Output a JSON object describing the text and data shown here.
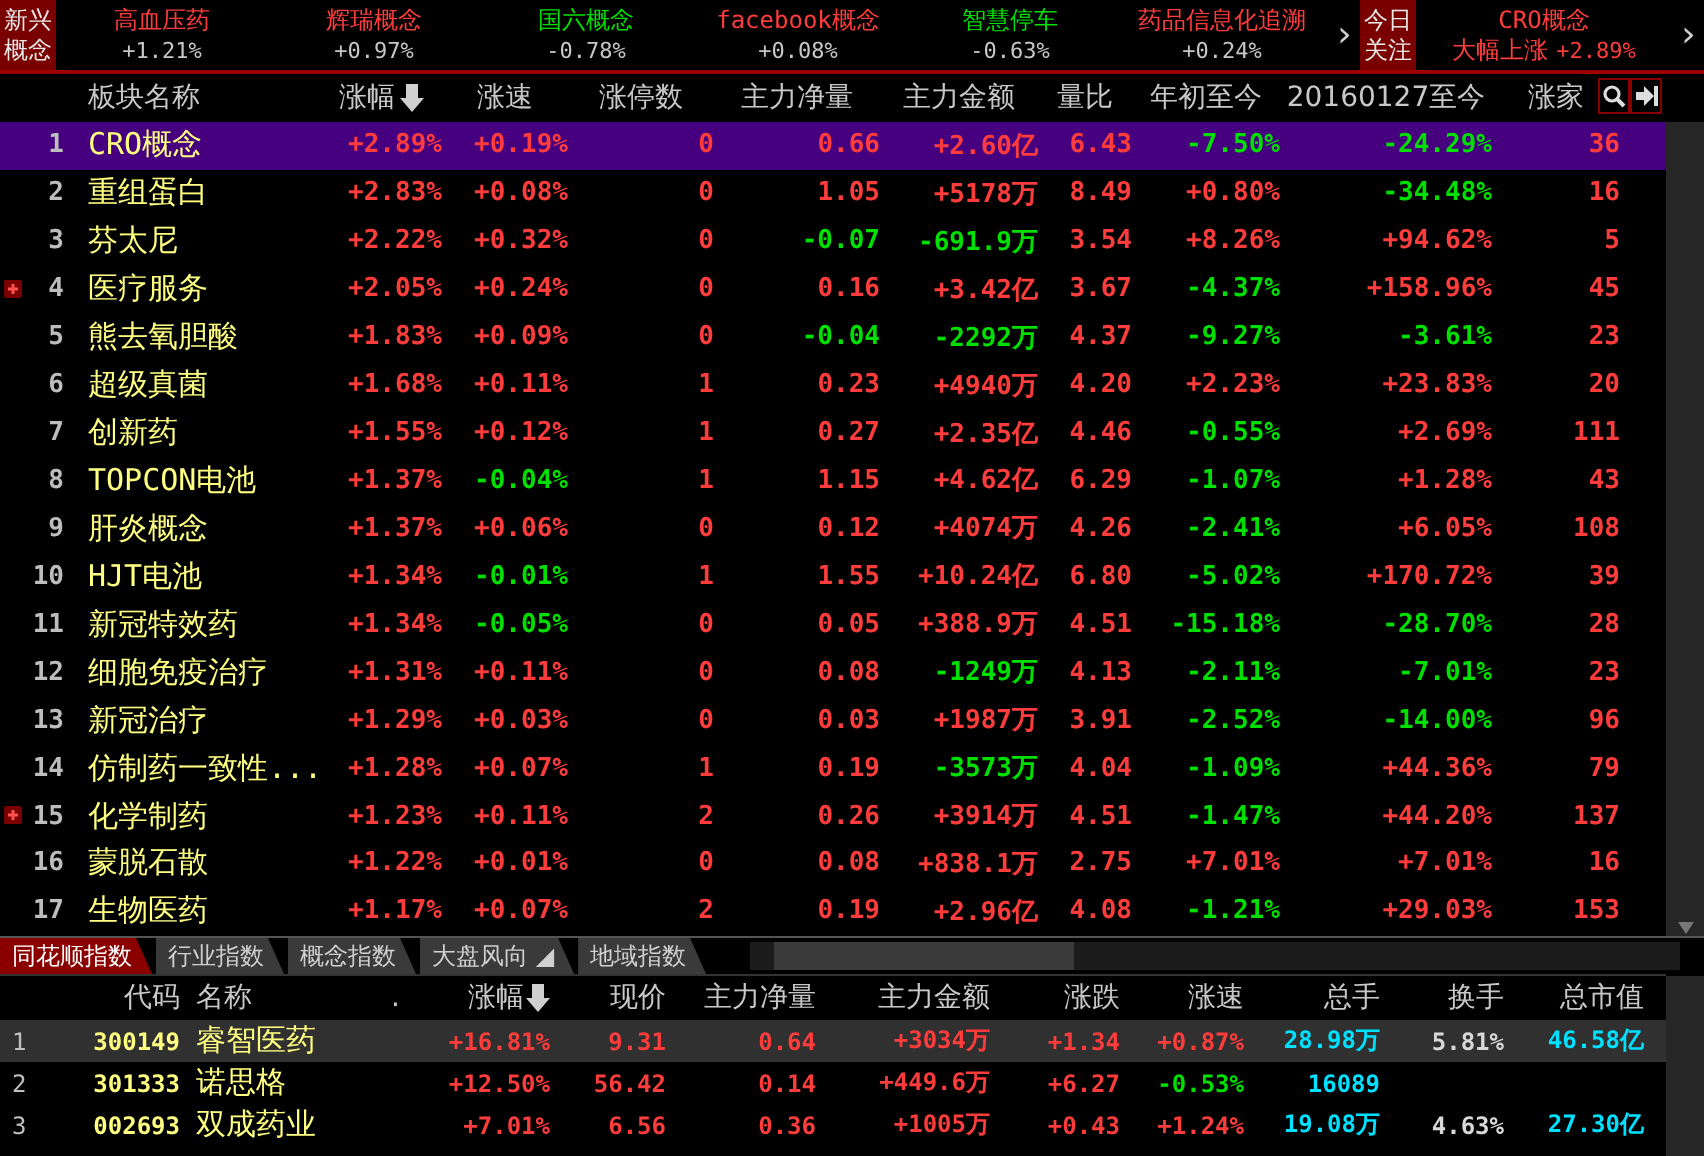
{
  "ticker": {
    "label": "新兴概念",
    "items": [
      {
        "name": "高血压药",
        "change": "+1.21%",
        "color": "#ff3c3c"
      },
      {
        "name": "辉瑞概念",
        "change": "+0.97%",
        "color": "#ff3c3c"
      },
      {
        "name": "国六概念",
        "change": "-0.78%",
        "color": "#00e000"
      },
      {
        "name": "facebook概念",
        "change": "+0.08%",
        "color": "#ff3c3c"
      },
      {
        "name": "智慧停车",
        "change": "-0.63%",
        "color": "#00e000"
      },
      {
        "name": "药品信息化追溯",
        "change": "+0.24%",
        "color": "#ff3c3c"
      }
    ],
    "arrow": "›",
    "focus_label": "今日关注",
    "focus": {
      "name": "CRO概念",
      "note": "大幅上涨",
      "change": "+2.89%",
      "color": "#ff3c3c"
    },
    "focus_arrow": "›"
  },
  "sectors": {
    "columns": [
      {},
      {
        "label": "板块名称",
        "sorted": false
      },
      {
        "label": "涨幅",
        "sorted": true
      },
      {
        "label": "涨速",
        "sorted": false
      },
      {
        "label": "涨停数",
        "sorted": false
      },
      {
        "label": "主力净量",
        "sorted": false
      },
      {
        "label": "主力金额",
        "sorted": false
      },
      {
        "label": "量比",
        "sorted": false
      },
      {
        "label": "年初至今",
        "sorted": false
      },
      {
        "label": "20160127至今",
        "sorted": false
      },
      {
        "label": "涨家",
        "sorted": false
      }
    ],
    "rows": [
      {
        "selected": true,
        "expandable": false,
        "cells": [
          {
            "text": "1",
            "color": "#bdbdbd"
          },
          {
            "text": "CRO概念",
            "color": "#ffff80"
          },
          {
            "text": "+2.89%",
            "color": "#ff3c3c"
          },
          {
            "text": "+0.19%",
            "color": "#ff3c3c"
          },
          {
            "text": "0",
            "color": "#ff3c3c"
          },
          {
            "text": "0.66",
            "color": "#ff3c3c"
          },
          {
            "text": "+2.60亿",
            "color": "#ff3c3c"
          },
          {
            "text": "6.43",
            "color": "#ff3c3c"
          },
          {
            "text": "-7.50%",
            "color": "#00e000"
          },
          {
            "text": "-24.29%",
            "color": "#00e000"
          },
          {
            "text": "36",
            "color": "#ff3c3c"
          }
        ]
      },
      {
        "selected": false,
        "expandable": false,
        "cells": [
          {
            "text": "2",
            "color": "#bdbdbd"
          },
          {
            "text": "重组蛋白",
            "color": "#ffff80"
          },
          {
            "text": "+2.83%",
            "color": "#ff3c3c"
          },
          {
            "text": "+0.08%",
            "color": "#ff3c3c"
          },
          {
            "text": "0",
            "color": "#ff3c3c"
          },
          {
            "text": "1.05",
            "color": "#ff3c3c"
          },
          {
            "text": "+5178万",
            "color": "#ff3c3c"
          },
          {
            "text": "8.49",
            "color": "#ff3c3c"
          },
          {
            "text": "+0.80%",
            "color": "#ff3c3c"
          },
          {
            "text": "-34.48%",
            "color": "#00e000"
          },
          {
            "text": "16",
            "color": "#ff3c3c"
          }
        ]
      },
      {
        "selected": false,
        "expandable": false,
        "cells": [
          {
            "text": "3",
            "color": "#bdbdbd"
          },
          {
            "text": "芬太尼",
            "color": "#ffff80"
          },
          {
            "text": "+2.22%",
            "color": "#ff3c3c"
          },
          {
            "text": "+0.32%",
            "color": "#ff3c3c"
          },
          {
            "text": "0",
            "color": "#ff3c3c"
          },
          {
            "text": "-0.07",
            "color": "#00e000"
          },
          {
            "text": "-691.9万",
            "color": "#00e000"
          },
          {
            "text": "3.54",
            "color": "#ff3c3c"
          },
          {
            "text": "+8.26%",
            "color": "#ff3c3c"
          },
          {
            "text": "+94.62%",
            "color": "#ff3c3c"
          },
          {
            "text": "5",
            "color": "#ff3c3c"
          }
        ]
      },
      {
        "selected": false,
        "expandable": true,
        "cells": [
          {
            "text": "4",
            "color": "#bdbdbd"
          },
          {
            "text": "医疗服务",
            "color": "#ffff80"
          },
          {
            "text": "+2.05%",
            "color": "#ff3c3c"
          },
          {
            "text": "+0.24%",
            "color": "#ff3c3c"
          },
          {
            "text": "0",
            "color": "#ff3c3c"
          },
          {
            "text": "0.16",
            "color": "#ff3c3c"
          },
          {
            "text": "+3.42亿",
            "color": "#ff3c3c"
          },
          {
            "text": "3.67",
            "color": "#ff3c3c"
          },
          {
            "text": "-4.37%",
            "color": "#00e000"
          },
          {
            "text": "+158.96%",
            "color": "#ff3c3c"
          },
          {
            "text": "45",
            "color": "#ff3c3c"
          }
        ]
      },
      {
        "selected": false,
        "expandable": false,
        "cells": [
          {
            "text": "5",
            "color": "#bdbdbd"
          },
          {
            "text": "熊去氧胆酸",
            "color": "#ffff80"
          },
          {
            "text": "+1.83%",
            "color": "#ff3c3c"
          },
          {
            "text": "+0.09%",
            "color": "#ff3c3c"
          },
          {
            "text": "0",
            "color": "#ff3c3c"
          },
          {
            "text": "-0.04",
            "color": "#00e000"
          },
          {
            "text": "-2292万",
            "color": "#00e000"
          },
          {
            "text": "4.37",
            "color": "#ff3c3c"
          },
          {
            "text": "-9.27%",
            "color": "#00e000"
          },
          {
            "text": "-3.61%",
            "color": "#00e000"
          },
          {
            "text": "23",
            "color": "#ff3c3c"
          }
        ]
      },
      {
        "selected": false,
        "expandable": false,
        "cells": [
          {
            "text": "6",
            "color": "#bdbdbd"
          },
          {
            "text": "超级真菌",
            "color": "#ffff80"
          },
          {
            "text": "+1.68%",
            "color": "#ff3c3c"
          },
          {
            "text": "+0.11%",
            "color": "#ff3c3c"
          },
          {
            "text": "1",
            "color": "#ff3c3c"
          },
          {
            "text": "0.23",
            "color": "#ff3c3c"
          },
          {
            "text": "+4940万",
            "color": "#ff3c3c"
          },
          {
            "text": "4.20",
            "color": "#ff3c3c"
          },
          {
            "text": "+2.23%",
            "color": "#ff3c3c"
          },
          {
            "text": "+23.83%",
            "color": "#ff3c3c"
          },
          {
            "text": "20",
            "color": "#ff3c3c"
          }
        ]
      },
      {
        "selected": false,
        "expandable": false,
        "cells": [
          {
            "text": "7",
            "color": "#bdbdbd"
          },
          {
            "text": "创新药",
            "color": "#ffff80"
          },
          {
            "text": "+1.55%",
            "color": "#ff3c3c"
          },
          {
            "text": "+0.12%",
            "color": "#ff3c3c"
          },
          {
            "text": "1",
            "color": "#ff3c3c"
          },
          {
            "text": "0.27",
            "color": "#ff3c3c"
          },
          {
            "text": "+2.35亿",
            "color": "#ff3c3c"
          },
          {
            "text": "4.46",
            "color": "#ff3c3c"
          },
          {
            "text": "-0.55%",
            "color": "#00e000"
          },
          {
            "text": "+2.69%",
            "color": "#ff3c3c"
          },
          {
            "text": "111",
            "color": "#ff3c3c"
          }
        ]
      },
      {
        "selected": false,
        "expandable": false,
        "cells": [
          {
            "text": "8",
            "color": "#bdbdbd"
          },
          {
            "text": "TOPCON电池",
            "color": "#ffff80"
          },
          {
            "text": "+1.37%",
            "color": "#ff3c3c"
          },
          {
            "text": "-0.04%",
            "color": "#00e000"
          },
          {
            "text": "1",
            "color": "#ff3c3c"
          },
          {
            "text": "1.15",
            "color": "#ff3c3c"
          },
          {
            "text": "+4.62亿",
            "color": "#ff3c3c"
          },
          {
            "text": "6.29",
            "color": "#ff3c3c"
          },
          {
            "text": "-1.07%",
            "color": "#00e000"
          },
          {
            "text": "+1.28%",
            "color": "#ff3c3c"
          },
          {
            "text": "43",
            "color": "#ff3c3c"
          }
        ]
      },
      {
        "selected": false,
        "expandable": false,
        "cells": [
          {
            "text": "9",
            "color": "#bdbdbd"
          },
          {
            "text": "肝炎概念",
            "color": "#ffff80"
          },
          {
            "text": "+1.37%",
            "color": "#ff3c3c"
          },
          {
            "text": "+0.06%",
            "color": "#ff3c3c"
          },
          {
            "text": "0",
            "color": "#ff3c3c"
          },
          {
            "text": "0.12",
            "color": "#ff3c3c"
          },
          {
            "text": "+4074万",
            "color": "#ff3c3c"
          },
          {
            "text": "4.26",
            "color": "#ff3c3c"
          },
          {
            "text": "-2.41%",
            "color": "#00e000"
          },
          {
            "text": "+6.05%",
            "color": "#ff3c3c"
          },
          {
            "text": "108",
            "color": "#ff3c3c"
          }
        ]
      },
      {
        "selected": false,
        "expandable": false,
        "cells": [
          {
            "text": "10",
            "color": "#bdbdbd"
          },
          {
            "text": "HJT电池",
            "color": "#ffff80"
          },
          {
            "text": "+1.34%",
            "color": "#ff3c3c"
          },
          {
            "text": "-0.01%",
            "color": "#00e000"
          },
          {
            "text": "1",
            "color": "#ff3c3c"
          },
          {
            "text": "1.55",
            "color": "#ff3c3c"
          },
          {
            "text": "+10.24亿",
            "color": "#ff3c3c"
          },
          {
            "text": "6.80",
            "color": "#ff3c3c"
          },
          {
            "text": "-5.02%",
            "color": "#00e000"
          },
          {
            "text": "+170.72%",
            "color": "#ff3c3c"
          },
          {
            "text": "39",
            "color": "#ff3c3c"
          }
        ]
      },
      {
        "selected": false,
        "expandable": false,
        "cells": [
          {
            "text": "11",
            "color": "#bdbdbd"
          },
          {
            "text": "新冠特效药",
            "color": "#ffff80"
          },
          {
            "text": "+1.34%",
            "color": "#ff3c3c"
          },
          {
            "text": "-0.05%",
            "color": "#00e000"
          },
          {
            "text": "0",
            "color": "#ff3c3c"
          },
          {
            "text": "0.05",
            "color": "#ff3c3c"
          },
          {
            "text": "+388.9万",
            "color": "#ff3c3c"
          },
          {
            "text": "4.51",
            "color": "#ff3c3c"
          },
          {
            "text": "-15.18%",
            "color": "#00e000"
          },
          {
            "text": "-28.70%",
            "color": "#00e000"
          },
          {
            "text": "28",
            "color": "#ff3c3c"
          }
        ]
      },
      {
        "selected": false,
        "expandable": false,
        "cells": [
          {
            "text": "12",
            "color": "#bdbdbd"
          },
          {
            "text": "细胞免疫治疗",
            "color": "#ffff80"
          },
          {
            "text": "+1.31%",
            "color": "#ff3c3c"
          },
          {
            "text": "+0.11%",
            "color": "#ff3c3c"
          },
          {
            "text": "0",
            "color": "#ff3c3c"
          },
          {
            "text": "0.08",
            "color": "#ff3c3c"
          },
          {
            "text": "-1249万",
            "color": "#00e000"
          },
          {
            "text": "4.13",
            "color": "#ff3c3c"
          },
          {
            "text": "-2.11%",
            "color": "#00e000"
          },
          {
            "text": "-7.01%",
            "color": "#00e000"
          },
          {
            "text": "23",
            "color": "#ff3c3c"
          }
        ]
      },
      {
        "selected": false,
        "expandable": false,
        "cells": [
          {
            "text": "13",
            "color": "#bdbdbd"
          },
          {
            "text": "新冠治疗",
            "color": "#ffff80"
          },
          {
            "text": "+1.29%",
            "color": "#ff3c3c"
          },
          {
            "text": "+0.03%",
            "color": "#ff3c3c"
          },
          {
            "text": "0",
            "color": "#ff3c3c"
          },
          {
            "text": "0.03",
            "color": "#ff3c3c"
          },
          {
            "text": "+1987万",
            "color": "#ff3c3c"
          },
          {
            "text": "3.91",
            "color": "#ff3c3c"
          },
          {
            "text": "-2.52%",
            "color": "#00e000"
          },
          {
            "text": "-14.00%",
            "color": "#00e000"
          },
          {
            "text": "96",
            "color": "#ff3c3c"
          }
        ]
      },
      {
        "selected": false,
        "expandable": false,
        "cells": [
          {
            "text": "14",
            "color": "#bdbdbd"
          },
          {
            "text": "仿制药一致性...",
            "color": "#ffff80"
          },
          {
            "text": "+1.28%",
            "color": "#ff3c3c"
          },
          {
            "text": "+0.07%",
            "color": "#ff3c3c"
          },
          {
            "text": "1",
            "color": "#ff3c3c"
          },
          {
            "text": "0.19",
            "color": "#ff3c3c"
          },
          {
            "text": "-3573万",
            "color": "#00e000"
          },
          {
            "text": "4.04",
            "color": "#ff3c3c"
          },
          {
            "text": "-1.09%",
            "color": "#00e000"
          },
          {
            "text": "+44.36%",
            "color": "#ff3c3c"
          },
          {
            "text": "79",
            "color": "#ff3c3c"
          }
        ]
      },
      {
        "selected": false,
        "expandable": true,
        "cells": [
          {
            "text": "15",
            "color": "#bdbdbd"
          },
          {
            "text": "化学制药",
            "color": "#ffff80"
          },
          {
            "text": "+1.23%",
            "color": "#ff3c3c"
          },
          {
            "text": "+0.11%",
            "color": "#ff3c3c"
          },
          {
            "text": "2",
            "color": "#ff3c3c"
          },
          {
            "text": "0.26",
            "color": "#ff3c3c"
          },
          {
            "text": "+3914万",
            "color": "#ff3c3c"
          },
          {
            "text": "4.51",
            "color": "#ff3c3c"
          },
          {
            "text": "-1.47%",
            "color": "#00e000"
          },
          {
            "text": "+44.20%",
            "color": "#ff3c3c"
          },
          {
            "text": "137",
            "color": "#ff3c3c"
          }
        ]
      },
      {
        "selected": false,
        "expandable": false,
        "cells": [
          {
            "text": "16",
            "color": "#bdbdbd"
          },
          {
            "text": "蒙脱石散",
            "color": "#ffff80"
          },
          {
            "text": "+1.22%",
            "color": "#ff3c3c"
          },
          {
            "text": "+0.01%",
            "color": "#ff3c3c"
          },
          {
            "text": "0",
            "color": "#ff3c3c"
          },
          {
            "text": "0.08",
            "color": "#ff3c3c"
          },
          {
            "text": "+838.1万",
            "color": "#ff3c3c"
          },
          {
            "text": "2.75",
            "color": "#ff3c3c"
          },
          {
            "text": "+7.01%",
            "color": "#ff3c3c"
          },
          {
            "text": "+7.01%",
            "color": "#ff3c3c"
          },
          {
            "text": "16",
            "color": "#ff3c3c"
          }
        ]
      },
      {
        "selected": false,
        "expandable": false,
        "cells": [
          {
            "text": "17",
            "color": "#bdbdbd"
          },
          {
            "text": "生物医药",
            "color": "#ffff80"
          },
          {
            "text": "+1.17%",
            "color": "#ff3c3c"
          },
          {
            "text": "+0.07%",
            "color": "#ff3c3c"
          },
          {
            "text": "2",
            "color": "#ff3c3c"
          },
          {
            "text": "0.19",
            "color": "#ff3c3c"
          },
          {
            "text": "+2.96亿",
            "color": "#ff3c3c"
          },
          {
            "text": "4.08",
            "color": "#ff3c3c"
          },
          {
            "text": "-1.21%",
            "color": "#00e000"
          },
          {
            "text": "+29.03%",
            "color": "#ff3c3c"
          },
          {
            "text": "153",
            "color": "#ff3c3c"
          }
        ]
      }
    ]
  },
  "index_tabs": [
    {
      "label": "同花顺指数",
      "selected": true
    },
    {
      "label": "行业指数",
      "selected": false
    },
    {
      "label": "概念指数",
      "selected": false
    },
    {
      "label": "大盘风向 ◢",
      "selected": false
    },
    {
      "label": "地域指数",
      "selected": false
    }
  ],
  "stocks": {
    "columns": [
      {},
      {
        "label": "代码",
        "sorted": false
      },
      {
        "label": "名称",
        "sorted": false
      },
      {
        "label": ".",
        "sorted": false
      },
      {
        "label": "涨幅",
        "sorted": true
      },
      {
        "label": "现价",
        "sorted": false
      },
      {
        "label": "主力净量",
        "sorted": false
      },
      {
        "label": "主力金额",
        "sorted": false
      },
      {
        "label": "涨跌",
        "sorted": false
      },
      {
        "label": "涨速",
        "sorted": false
      },
      {
        "label": "总手",
        "sorted": false
      },
      {
        "label": "换手",
        "sorted": false
      },
      {
        "label": "总市值",
        "sorted": false
      }
    ],
    "rows": [
      {
        "selected": true,
        "cells": [
          {
            "text": "1",
            "color": "#c0c0c0"
          },
          {
            "text": "300149",
            "color": "#ffff80"
          },
          {
            "text": "睿智医药",
            "color": "#ffff80"
          },
          {
            "text": ""
          },
          {
            "text": "+16.81%",
            "color": "#ff3c3c"
          },
          {
            "text": "9.31",
            "color": "#ff3c3c"
          },
          {
            "text": "0.64",
            "color": "#ff3c3c"
          },
          {
            "text": "+3034万",
            "color": "#ff3c3c"
          },
          {
            "text": "+1.34",
            "color": "#ff3c3c"
          },
          {
            "text": "+0.87%",
            "color": "#ff3c3c"
          },
          {
            "text": "28.98万",
            "color": "#00e0ff"
          },
          {
            "text": "5.81%",
            "color": "#d8d8d8"
          },
          {
            "text": "46.58亿",
            "color": "#00e0ff"
          }
        ]
      },
      {
        "selected": false,
        "cells": [
          {
            "text": "2",
            "color": "#c0c0c0"
          },
          {
            "text": "301333",
            "color": "#ffff80"
          },
          {
            "text": "诺思格",
            "color": "#ffff80"
          },
          {
            "text": ""
          },
          {
            "text": "+12.50%",
            "color": "#ff3c3c"
          },
          {
            "text": "56.42",
            "color": "#ff3c3c"
          },
          {
            "text": "0.14",
            "color": "#ff3c3c"
          },
          {
            "text": "+449.6万",
            "color": "#ff3c3c"
          },
          {
            "text": "+6.27",
            "color": "#ff3c3c"
          },
          {
            "text": "-0.53%",
            "color": "#00e000"
          },
          {
            "text": "16089",
            "color": "#00e0ff"
          }
        ]
      },
      {
        "selected": false,
        "cells": [
          {
            "text": "3",
            "color": "#c0c0c0"
          },
          {
            "text": "002693",
            "color": "#ffff80"
          },
          {
            "text": "双成药业",
            "color": "#ffff80"
          },
          {
            "text": ""
          },
          {
            "text": "+7.01%",
            "color": "#ff3c3c"
          },
          {
            "text": "6.56",
            "color": "#ff3c3c"
          },
          {
            "text": "0.36",
            "color": "#ff3c3c"
          },
          {
            "text": "+1005万",
            "color": "#ff3c3c"
          },
          {
            "text": "+0.43",
            "color": "#ff3c3c"
          },
          {
            "text": "+1.24%",
            "color": "#ff3c3c"
          },
          {
            "text": "19.08万",
            "color": "#00e0ff"
          },
          {
            "text": "4.63%",
            "color": "#d8d8d8"
          },
          {
            "text": "27.30亿",
            "color": "#00e0ff"
          }
        ]
      }
    ]
  }
}
